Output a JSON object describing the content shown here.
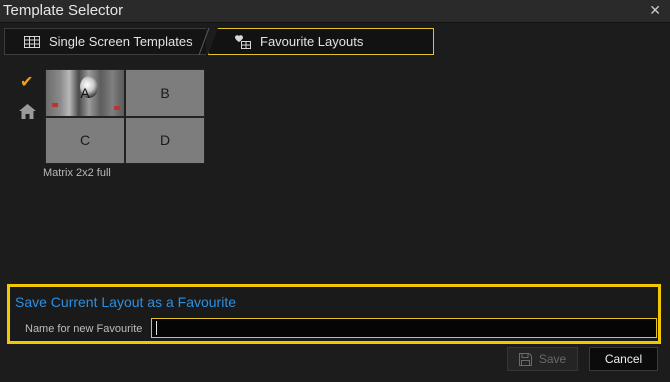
{
  "window": {
    "title": "Template Selector",
    "close_glyph": "✕"
  },
  "tabs": [
    {
      "label": "Single Screen Templates",
      "icon": "grid-icon",
      "active": false
    },
    {
      "label": "Favourite Layouts",
      "icon": "favourite-layout-icon",
      "active": true
    }
  ],
  "side_icons": {
    "check_glyph": "✔",
    "check_color": "#f0a020",
    "home_icon": "home-icon"
  },
  "layout": {
    "name": "Matrix 2x2 full",
    "cells": [
      "A",
      "B",
      "C",
      "D"
    ]
  },
  "favourite": {
    "title": "Save Current Layout as a Favourite",
    "name_label": "Name for new Favourite",
    "name_value": "",
    "name_placeholder": ""
  },
  "buttons": {
    "save": "Save",
    "cancel": "Cancel"
  },
  "colors": {
    "accent_yellow": "#f2c800",
    "link_blue": "#2e8fe0"
  }
}
